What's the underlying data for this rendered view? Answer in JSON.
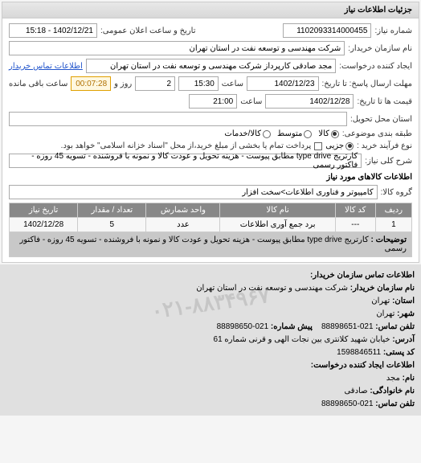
{
  "panel": {
    "title": "جزئیات اطلاعات نیاز"
  },
  "header": {
    "need_no_label": "شماره نیاز:",
    "need_no": "1102093314000455",
    "announce_label": "تاریخ و ساعت اعلان عمومی:",
    "announce_value": "1402/12/21 - 15:18",
    "buyer_label": "نام سازمان خریدار:",
    "buyer_value": "شرکت مهندسی و توسعه نفت در استان تهران",
    "requester_label": "ایجاد کننده درخواست:",
    "requester_value": "مجد صادقی کارپرداز شرکت مهندسی و توسعه نفت در استان تهران",
    "contact_link": "اطلاعات تماس خریدار",
    "deadline_send_label": "مهلت ارسال پاسخ: تا تاریخ:",
    "deadline_send_date": "1402/12/23",
    "time_label": "ساعت",
    "deadline_send_time": "15:30",
    "remaining_label_days": "روز و",
    "remaining_days": "2",
    "remaining_time": "00:07:28",
    "remaining_suffix": "ساعت باقی مانده",
    "deadline_valid_label": "قیمت ها تا تاریخ:",
    "deadline_valid_date": "1402/12/28",
    "deadline_valid_time": "21:00",
    "delivery_place_label": "استان محل تحویل:",
    "delivery_place": "",
    "subject_pack_label": "طبقه بندی موضوعی:",
    "pack_options": {
      "kala": "کالا",
      "medium": "متوسط",
      "kala_khadamat": "کالا/خدمات"
    },
    "buy_type_label": "نوع فرآیند خرید :",
    "buy_options": {
      "partial": "جزیی",
      "full_note": "پرداخت تمام یا بخشی از مبلغ خرید،از محل \"اسناد خزانه اسلامی\" خواهد بود."
    },
    "keyword_label": "شرح کلی نیاز:",
    "keyword_value": "کارتریج type drive مطابق پیوست - هزینه تحویل و عودت کالا و نمونه با فروشنده - تسویه 45 روزه - فاکتور رسمی"
  },
  "goods": {
    "section_title": "اطلاعات کالاهای مورد نیاز",
    "group_label": "گروه کالا:",
    "group_value": "کامپیوتر و فناوری اطلاعات>سخت افزار",
    "columns": {
      "row": "ردیف",
      "code": "کد کالا",
      "name": "نام کالا",
      "unit": "واحد شمارش",
      "qty": "تعداد / مقدار",
      "date": "تاریخ نیاز"
    },
    "rows": [
      {
        "row": "1",
        "code": "---",
        "name": "برد جمع آوری اطلاعات",
        "unit": "عدد",
        "qty": "5",
        "date": "1402/12/28"
      }
    ],
    "desc_label": "توضیحات :",
    "desc_value": "کارتریج type drive مطابق پیوست - هزینه تحویل و عودت کالا و نمونه با فروشنده - تسویه 45 روزه - فاکتور رسمی"
  },
  "contact": {
    "title": "اطلاعات تماس سازمان خریدار:",
    "org_label": "نام سازمان خریدار:",
    "org_value": "شرکت مهندسی و توسعه نفت در استان تهران",
    "province_label": "استان:",
    "province_value": "تهران",
    "city_label": "شهر:",
    "city_value": "تهران",
    "prefix_label": "پیش شماره:",
    "prefix_value": "021-88898650",
    "phone_label": "تلفن تماس:",
    "phone_value": "021-88898651",
    "address_label": "آدرس:",
    "address_value": "خیابان شهید کلانتری بین نجات الهی و قرنی شماره 61",
    "postal_label": "کد پستی:",
    "postal_value": "1598846511",
    "requester_section": "اطلاعات ایجاد کننده درخواست:",
    "name_label": "نام:",
    "name_value": "مجد",
    "family_label": "نام خانوادگی:",
    "family_value": "صادقی",
    "req_phone_label": "تلفن تماس:",
    "req_phone_value": "021-88898650"
  },
  "watermark": "۰۲۱-۸۸۳۴۹۶۷"
}
